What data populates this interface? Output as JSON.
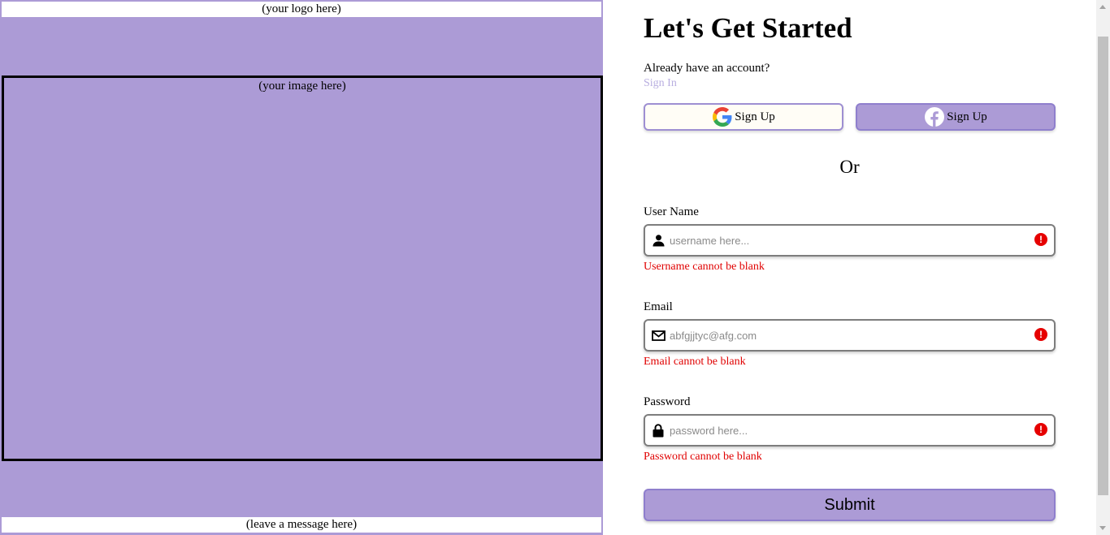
{
  "left": {
    "logo_text": "(your logo here)",
    "image_text": "(your image here)",
    "message_text": "(leave a message here)"
  },
  "form": {
    "title": "Let's Get Started",
    "already_text": "Already have an account?",
    "sign_in_link": "Sign In",
    "google_button_label": "Sign Up",
    "facebook_button_label": "Sign Up",
    "or_text": "Or",
    "username": {
      "label": "User Name",
      "placeholder": "username here...",
      "icon": "user-icon",
      "error": "Username cannot be blank"
    },
    "email": {
      "label": "Email",
      "placeholder": "abfgjjtyc@afg.com",
      "icon": "envelope-icon",
      "error": "Email cannot be blank"
    },
    "password": {
      "label": "Password",
      "placeholder": "password here...",
      "icon": "lock-icon",
      "error": "Password cannot be blank"
    },
    "error_icon_glyph": "!",
    "submit_label": "Submit"
  },
  "colors": {
    "accent": "#ac9bd6",
    "link": "#b8aee0",
    "error": "#e00000",
    "facebook_blue": "#1877f2"
  }
}
